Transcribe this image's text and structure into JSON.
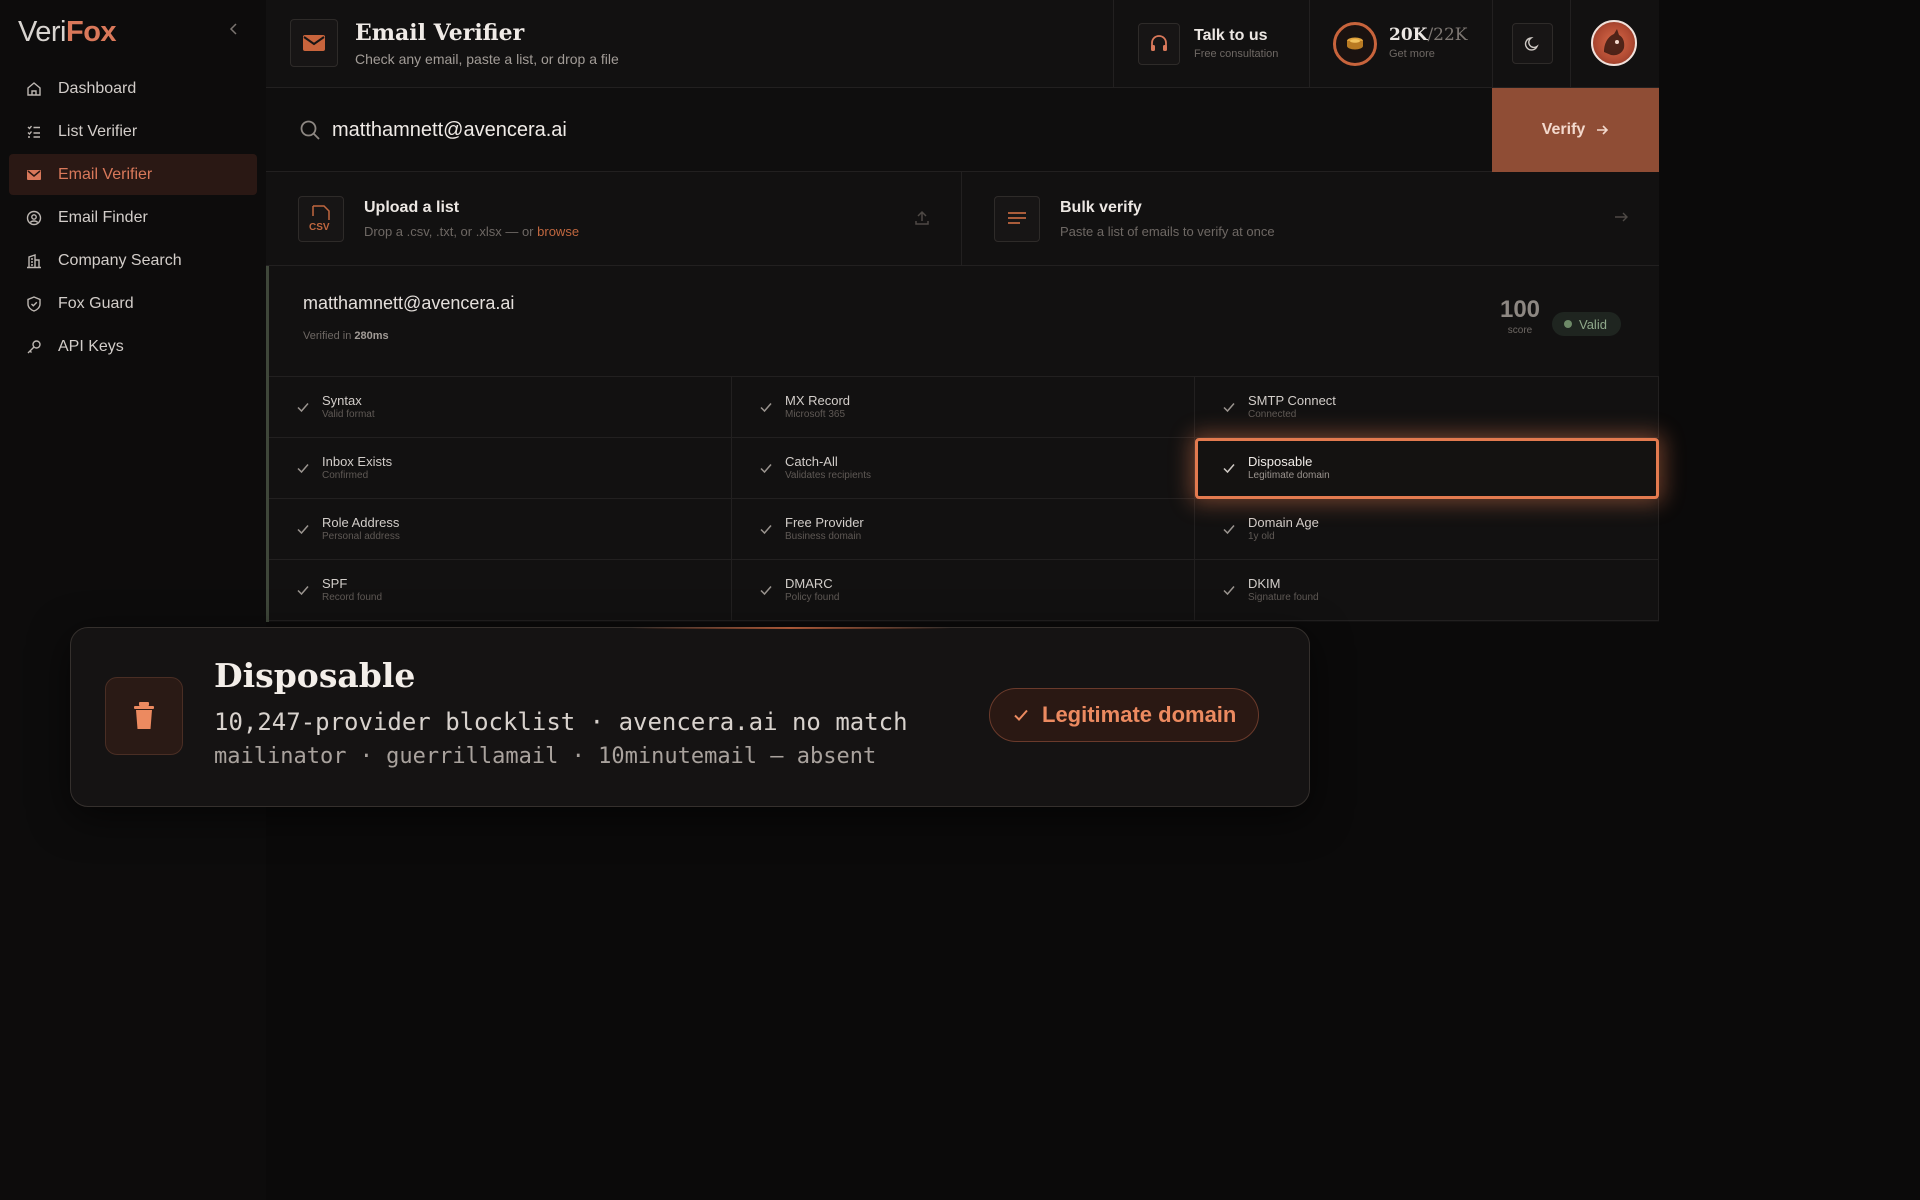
{
  "brand": {
    "part1": "Veri",
    "part2": "Fox"
  },
  "sidebar": {
    "items": [
      {
        "label": "Dashboard",
        "icon": "home-icon"
      },
      {
        "label": "List Verifier",
        "icon": "list-icon"
      },
      {
        "label": "Email Verifier",
        "icon": "mail-icon",
        "active": true
      },
      {
        "label": "Email Finder",
        "icon": "user-search-icon"
      },
      {
        "label": "Company Search",
        "icon": "building-icon"
      },
      {
        "label": "Fox Guard",
        "icon": "shield-icon"
      },
      {
        "label": "API Keys",
        "icon": "key-icon"
      }
    ]
  },
  "header": {
    "title": "Email Verifier",
    "subtitle": "Check any email, paste a list, or drop a file",
    "talk": {
      "title": "Talk to us",
      "subtitle": "Free consultation"
    },
    "credits": {
      "used": "20K",
      "total": "/22K",
      "subtitle": "Get more"
    }
  },
  "search": {
    "value": "matthamnett@avencera.ai",
    "button": "Verify"
  },
  "upload": {
    "title": "Upload a list",
    "desc": "Drop a .csv, .txt, or .xlsx — or ",
    "browse": "browse",
    "badge": "CSV"
  },
  "bulk": {
    "title": "Bulk verify",
    "desc": "Paste a list of emails to verify at once"
  },
  "result": {
    "email": "matthamnett@avencera.ai",
    "verified_prefix": "Verified in ",
    "verified_time": "280ms",
    "score": "100",
    "score_label": "score",
    "status": "Valid"
  },
  "checks": [
    [
      {
        "title": "Syntax",
        "sub": "Valid format"
      },
      {
        "title": "MX Record",
        "sub": "Microsoft 365"
      },
      {
        "title": "SMTP Connect",
        "sub": "Connected"
      }
    ],
    [
      {
        "title": "Inbox Exists",
        "sub": "Confirmed"
      },
      {
        "title": "Catch-All",
        "sub": "Validates recipients"
      },
      {
        "title": "Disposable",
        "sub": "Legitimate domain"
      }
    ],
    [
      {
        "title": "Role Address",
        "sub": "Personal address"
      },
      {
        "title": "Free Provider",
        "sub": "Business domain"
      },
      {
        "title": "Domain Age",
        "sub": "1y old"
      }
    ],
    [
      {
        "title": "SPF",
        "sub": "Record found"
      },
      {
        "title": "DMARC",
        "sub": "Policy found"
      },
      {
        "title": "DKIM",
        "sub": "Signature found"
      }
    ]
  ],
  "popup": {
    "title": "Disposable",
    "line1": "10,247-provider blocklist · avencera.ai no match",
    "line2": "mailinator · guerrillamail · 10minutemail — absent",
    "pill": "Legitimate domain",
    "icon": "trash-icon"
  },
  "colors": {
    "accent": "#d9785a",
    "highlight": "#e37a4f",
    "valid": "#8fa88a"
  }
}
